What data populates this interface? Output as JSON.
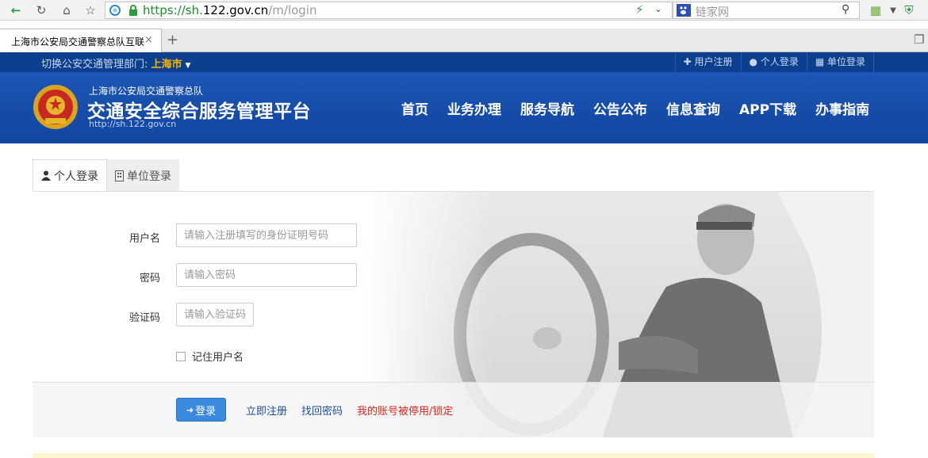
{
  "browser": {
    "url_scheme": "https://",
    "url_host_pre": "sh.",
    "url_host": "122.gov.cn",
    "url_path": "/m/login",
    "search_placeholder": "链家网",
    "tab_title": "上海市公安局交通警察总队互联",
    "tab_close": "×",
    "new_tab": "+"
  },
  "top_strip": {
    "dept_label": "切换公安交通管理部门: ",
    "dept_city": "上海市",
    "links": [
      "用户注册",
      "个人登录",
      "单位登录"
    ]
  },
  "header": {
    "org_name": "上海市公安局交通警察总队",
    "platform_name": "交通安全综合服务管理平台",
    "site_url": "http://sh.122.gov.cn",
    "nav": [
      "首页",
      "业务办理",
      "服务导航",
      "公告公布",
      "信息查询",
      "APP下载",
      "办事指南"
    ]
  },
  "login": {
    "tabs": [
      "个人登录",
      "单位登录"
    ],
    "username_label": "用户名",
    "username_placeholder": "请输入注册填写的身份证明号码",
    "password_label": "密码",
    "password_placeholder": "请输入密码",
    "captcha_label": "验证码",
    "captcha_placeholder": "请输入验证码",
    "remember_label": "记住用户名",
    "login_button": "登录",
    "register_link": "立即注册",
    "recover_link": "找回密码",
    "locked_link": "我的账号被停用/锁定"
  },
  "colors": {
    "header_blue": "#1c56b7",
    "strip_blue": "#0d3f8f",
    "city_gold": "#f5b800",
    "button_blue": "#3c8ae0",
    "alert_red": "#d9261c"
  }
}
